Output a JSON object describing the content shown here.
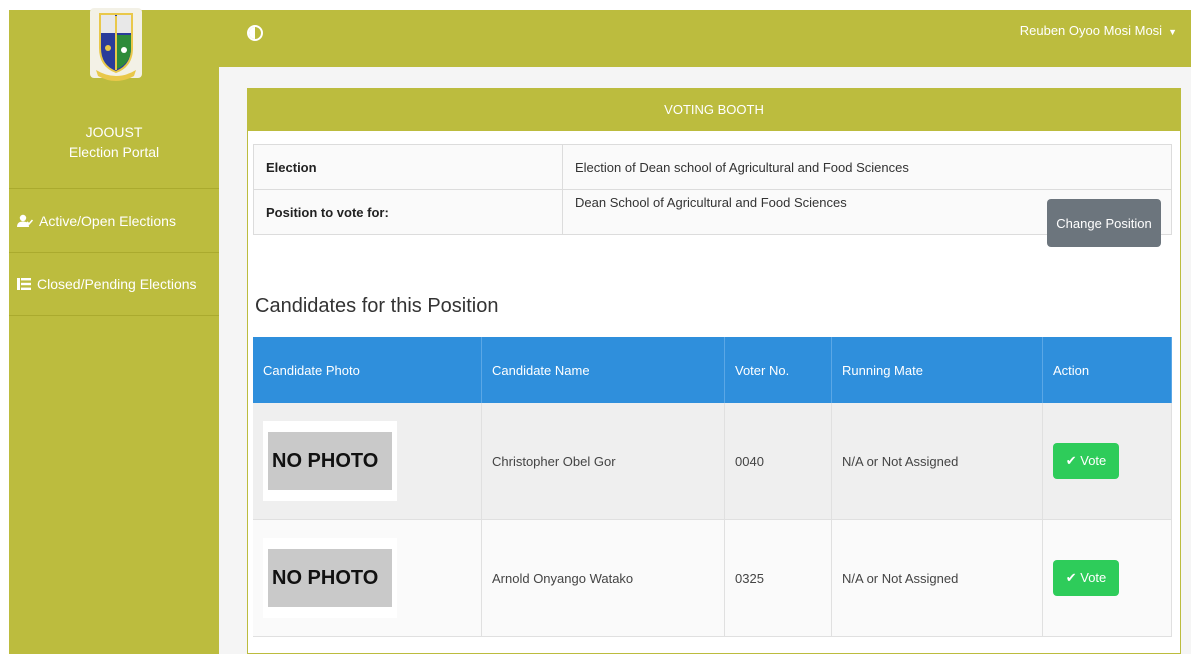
{
  "sidebar": {
    "brand_line1": "JOOUST",
    "brand_line2": "Election Portal",
    "items": [
      {
        "label": "Active/Open Elections",
        "icon": "user-check-icon"
      },
      {
        "label": "Closed/Pending Elections",
        "icon": "list-icon"
      }
    ]
  },
  "topbar": {
    "user_name": "Reuben Oyoo Mosi Mosi",
    "toggle_icon": "toggle-icon"
  },
  "panel": {
    "title": "VOTING BOOTH",
    "election_label": "Election",
    "election_value": "Election of Dean school of Agricultural and Food Sciences",
    "position_label": "Position to vote for:",
    "position_value": "Dean School of Agricultural and Food Sciences",
    "change_button": "Change Position"
  },
  "candidates": {
    "heading": "Candidates for this Position",
    "columns": [
      "Candidate Photo",
      "Candidate Name",
      "Voter No.",
      "Running Mate",
      "Action"
    ],
    "rows": [
      {
        "photo": "NO PHOTO",
        "name": "Christopher Obel Gor",
        "voter_no": "0040",
        "running_mate": "N/A or Not Assigned",
        "action": "Vote"
      },
      {
        "photo": "NO PHOTO",
        "name": "Arnold Onyango Watako",
        "voter_no": "0325",
        "running_mate": "N/A or Not Assigned",
        "action": "Vote"
      }
    ]
  },
  "colors": {
    "brand": "#bcbc3e",
    "table_header": "#2f8fdc",
    "vote_button": "#2ecc5a",
    "secondary_button": "#6c757d"
  }
}
